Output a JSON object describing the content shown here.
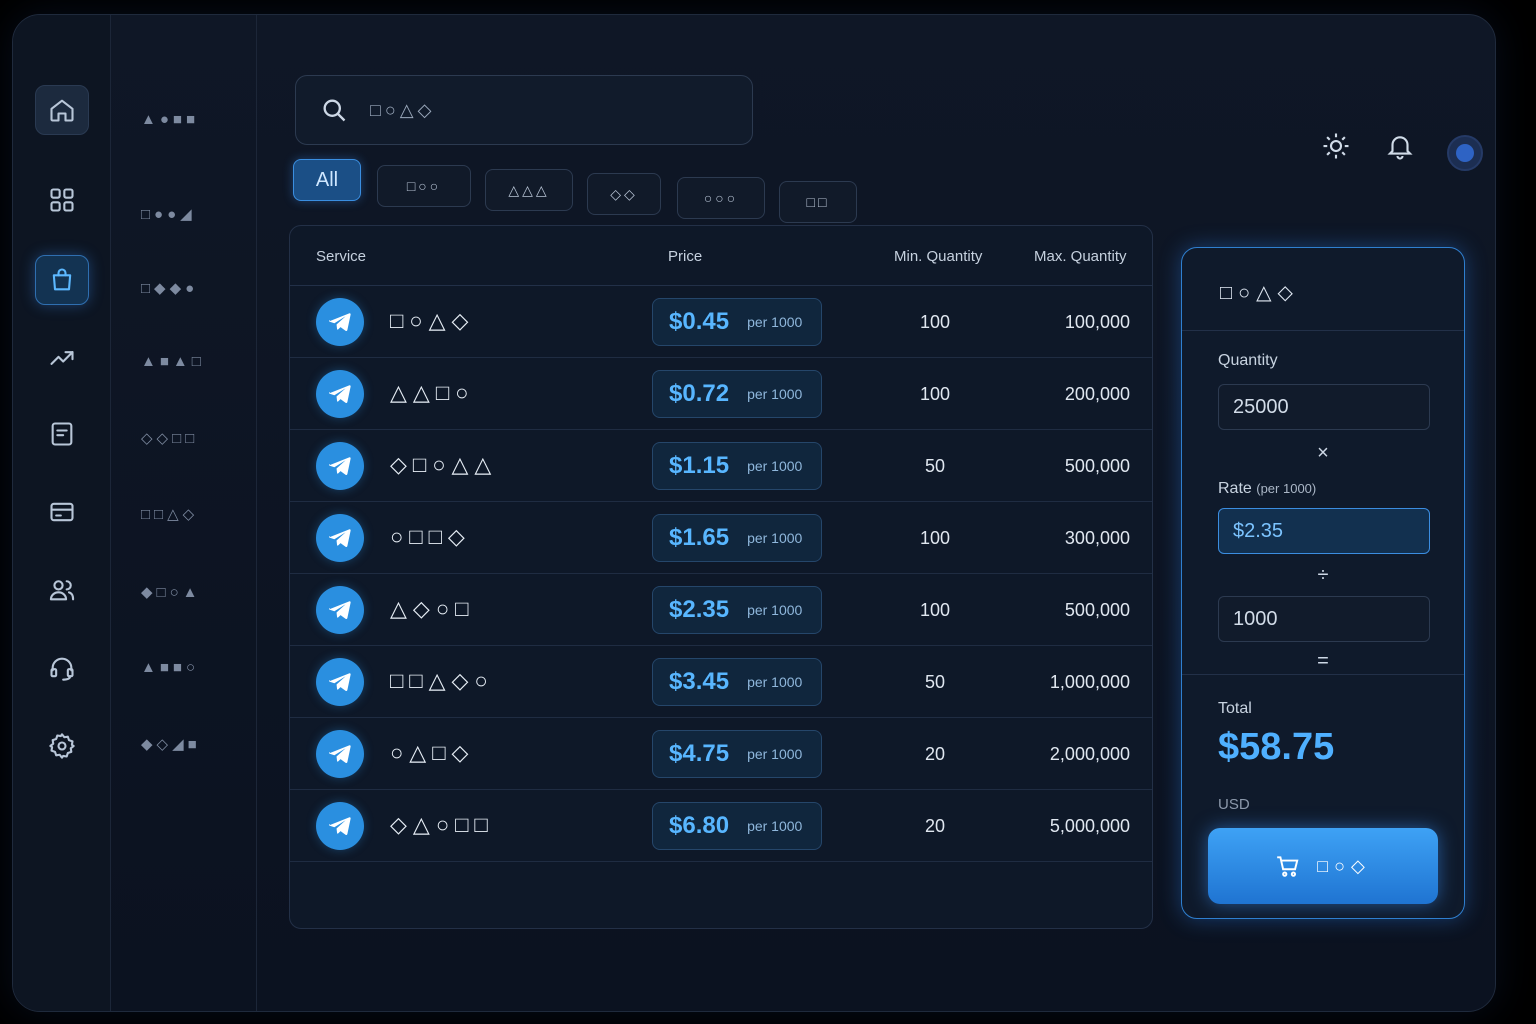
{
  "search": {
    "placeholder": "□○△◇"
  },
  "sidebar": {
    "nav": [
      "▲●■■",
      "□●●◢",
      "□◆◆●",
      "▲■▲□",
      "◇◇□□",
      "□□△◇",
      "◆□○▲",
      "▲■■○",
      "◆◇◢■"
    ]
  },
  "filters": [
    "All",
    "□○○",
    "△△△",
    "◇◇",
    "○○○",
    "□□"
  ],
  "table": {
    "headers": {
      "service": "Service",
      "price": "Price",
      "min": "Min. Quantity",
      "max": "Max. Quantity"
    },
    "rows": [
      {
        "name": "□○△◇",
        "price": "$0.45",
        "unit": "per 1000",
        "min": "100",
        "max": "100,000"
      },
      {
        "name": "△△□○",
        "price": "$0.72",
        "unit": "per 1000",
        "min": "100",
        "max": "200,000"
      },
      {
        "name": "◇□○△△",
        "price": "$1.15",
        "unit": "per 1000",
        "min": "50",
        "max": "500,000"
      },
      {
        "name": "○□□◇",
        "price": "$1.65",
        "unit": "per 1000",
        "min": "100",
        "max": "300,000"
      },
      {
        "name": "△◇○□",
        "price": "$2.35",
        "unit": "per 1000",
        "min": "100",
        "max": "500,000"
      },
      {
        "name": "□□△◇○",
        "price": "$3.45",
        "unit": "per 1000",
        "min": "50",
        "max": "1,000,000"
      },
      {
        "name": "○△□◇",
        "price": "$4.75",
        "unit": "per 1000",
        "min": "20",
        "max": "2,000,000"
      },
      {
        "name": "◇△○□□",
        "price": "$6.80",
        "unit": "per 1000",
        "min": "20",
        "max": "5,000,000"
      }
    ]
  },
  "calculator": {
    "title": "□○△◇",
    "quantity_label": "Quantity",
    "quantity_value": "25000",
    "times": "×",
    "rate_label": "Rate",
    "rate_note": "(per 1000)",
    "rate_value": "$2.35",
    "divide": "÷",
    "divisor_value": "1000",
    "equals": "=",
    "total_label": "Total",
    "total_value": "$58.75",
    "currency": "USD",
    "buy_label": "□○◇"
  },
  "colors": {
    "accent": "#3ea2f5",
    "background": "#0f1726",
    "price_text": "#58b6ff"
  }
}
